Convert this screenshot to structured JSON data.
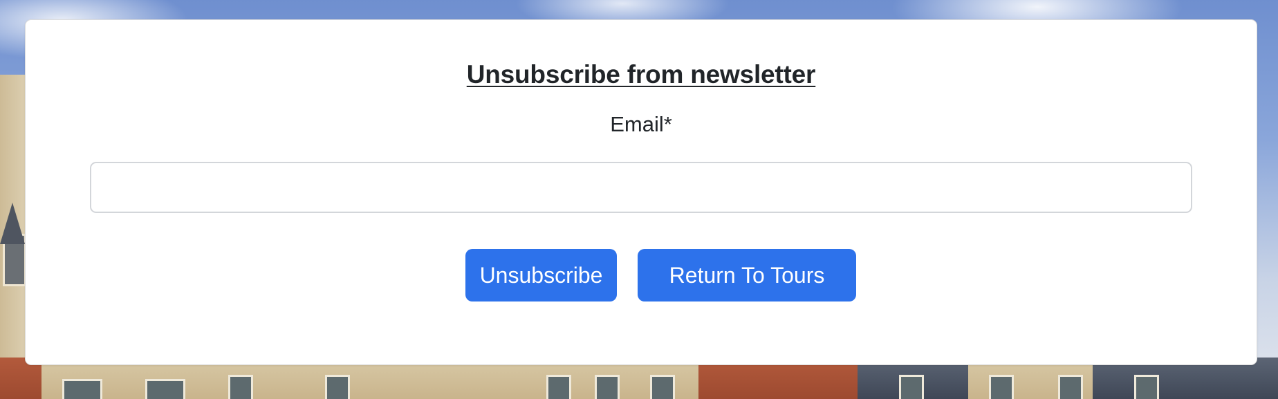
{
  "form": {
    "title": "Unsubscribe from newsletter",
    "email_label": "Email*",
    "email_value": "",
    "email_placeholder": ""
  },
  "buttons": {
    "unsubscribe_label": "Unsubscribe",
    "return_label": "Return To Tours"
  },
  "colors": {
    "accent": "#2d72eb",
    "card_background": "#ffffff",
    "text": "#212529"
  }
}
